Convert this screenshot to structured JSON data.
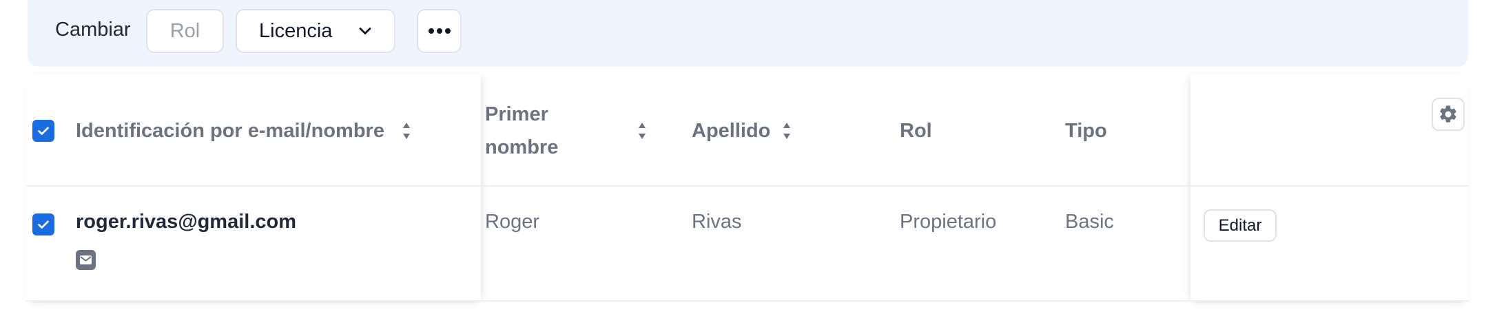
{
  "toolbar": {
    "change_label": "Cambiar",
    "role_button": "Rol",
    "license_button": "Licencia",
    "more_icon": "more-horizontal-icon"
  },
  "table": {
    "headers": {
      "email_name": "Identificación por e-mail/nombre",
      "first_name_line1": "Primer",
      "first_name_line2": "nombre",
      "last_name": "Apellido",
      "role": "Rol",
      "type": "Tipo"
    },
    "rows": [
      {
        "email": "roger.rivas@gmail.com",
        "first_name": "Roger",
        "last_name": "Rivas",
        "role": "Propietario",
        "type": "Basic",
        "edit_label": "Editar",
        "selected": true,
        "badge_icon": "mail-icon"
      }
    ],
    "header_checked": true,
    "settings_icon": "gear-icon"
  },
  "colors": {
    "accent": "#1a6ce0",
    "toolbar_bg": "#eef5fe",
    "header_text": "#6b7280"
  }
}
